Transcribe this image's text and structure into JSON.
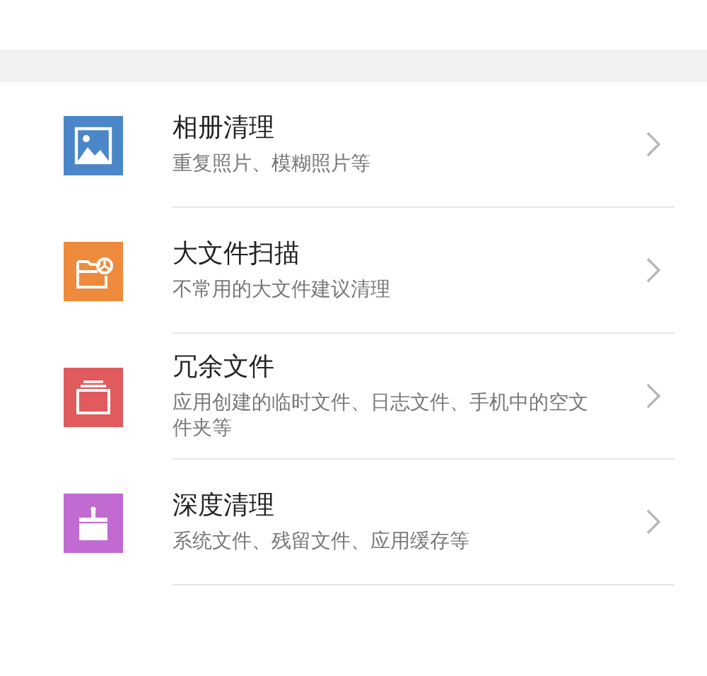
{
  "items": [
    {
      "title": "相册清理",
      "subtitle": "重复照片、模糊照片等",
      "kind": "photo",
      "color": "#4a86c8"
    },
    {
      "title": "大文件扫描",
      "subtitle": "不常用的大文件建议清理",
      "kind": "folder",
      "color": "#ee8a3c"
    },
    {
      "title": "冗余文件",
      "subtitle": "应用创建的临时文件、日志文件、手机中的空文件夹等",
      "kind": "stack",
      "color": "#e05a5e"
    },
    {
      "title": "深度清理",
      "subtitle": "系统文件、残留文件、应用缓存等",
      "kind": "brush",
      "color": "#c06ad2"
    }
  ]
}
